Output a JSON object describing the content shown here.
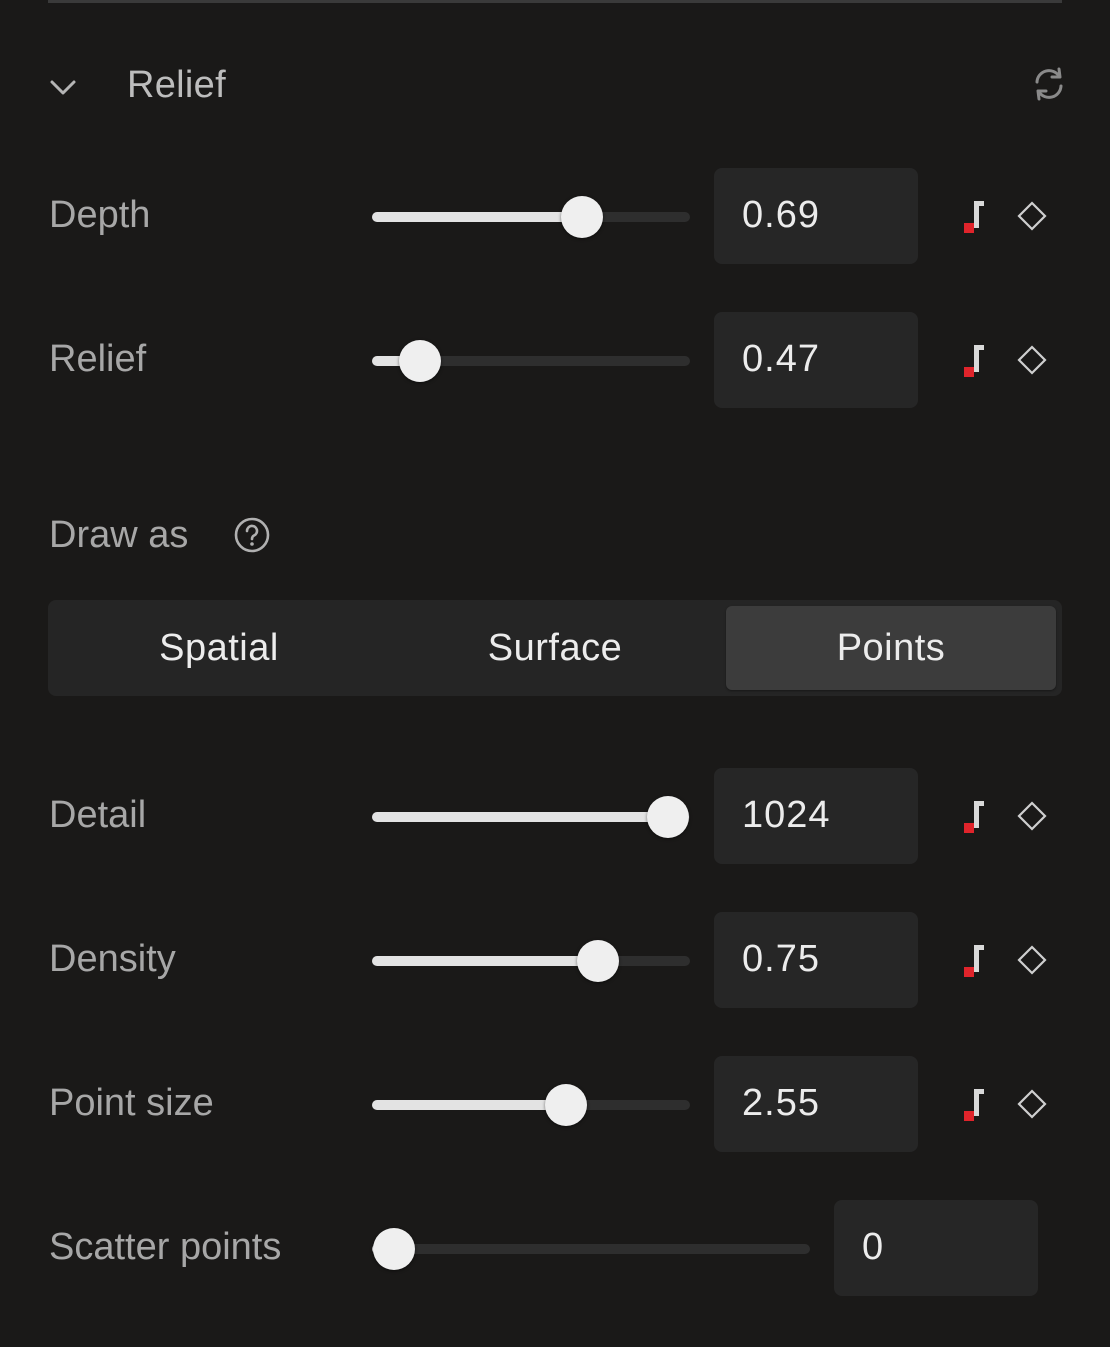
{
  "section": {
    "title": "Relief",
    "expanded": true
  },
  "icons": {
    "collapse": "chevron-down-icon",
    "reset": "refresh-icon",
    "animate": "animate-icon",
    "keyframe": "keyframe-diamond-icon",
    "help": "help-circle-icon"
  },
  "colors": {
    "background": "#1a1918",
    "field": "#262626",
    "accent_red": "#e0242b",
    "slider_fill": "#e3e3e3",
    "slider_track": "#2e2e2e"
  },
  "controls_top": [
    {
      "label": "Depth",
      "value": "0.69",
      "fill_fraction": 0.66
    },
    {
      "label": "Relief",
      "value": "0.47",
      "fill_fraction": 0.15
    }
  ],
  "draw_as": {
    "label": "Draw as",
    "options": [
      "Spatial",
      "Surface",
      "Points"
    ],
    "selected": "Points"
  },
  "controls_bottom": [
    {
      "label": "Detail",
      "value": "1024",
      "fill_fraction": 0.93
    },
    {
      "label": "Density",
      "value": "0.75",
      "fill_fraction": 0.71
    },
    {
      "label": "Point size",
      "value": "2.55",
      "fill_fraction": 0.61
    }
  ],
  "scatter": {
    "label": "Scatter points",
    "value": "0",
    "fill_fraction": 0.05
  }
}
